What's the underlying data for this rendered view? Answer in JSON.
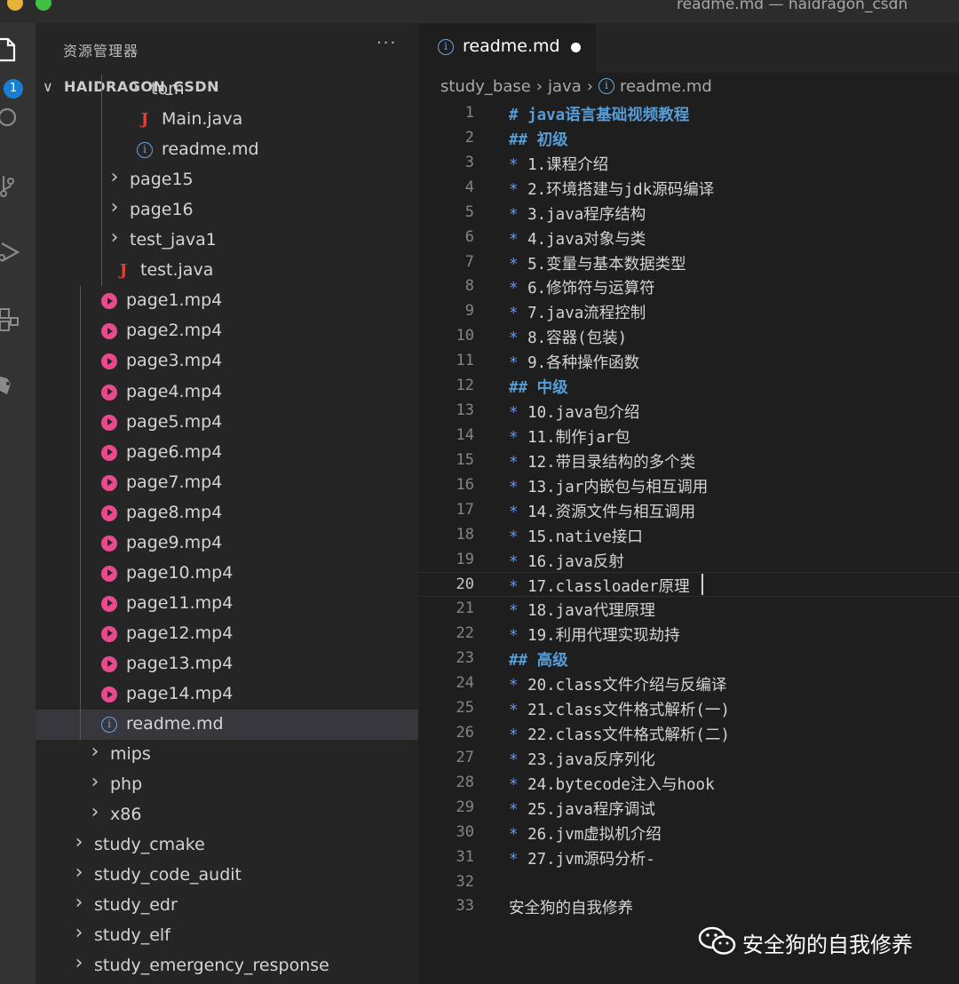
{
  "window": {
    "title": "readme.md — haidragon_csdn"
  },
  "activity_bar": {
    "badge_count": "1",
    "icons": [
      "files-icon",
      "search-icon",
      "source-control-icon",
      "run-debug-icon",
      "extensions-icon",
      "remote-icon"
    ]
  },
  "sidebar": {
    "title": "资源管理器",
    "more_label": "···",
    "workspace": "HAIDRAGON_CSDN",
    "items": [
      {
        "label": "tom",
        "kind": "folder",
        "depth": 3
      },
      {
        "label": "Main.java",
        "kind": "java",
        "depth": 3
      },
      {
        "label": "readme.md",
        "kind": "info",
        "depth": 3
      },
      {
        "label": "page15",
        "kind": "folder",
        "depth": 2
      },
      {
        "label": "page16",
        "kind": "folder",
        "depth": 2
      },
      {
        "label": "test_java1",
        "kind": "folder",
        "depth": 2
      },
      {
        "label": "test.java",
        "kind": "java",
        "depth": 2
      },
      {
        "label": "page1.mp4",
        "kind": "media",
        "depth": 1
      },
      {
        "label": "page2.mp4",
        "kind": "media",
        "depth": 1
      },
      {
        "label": "page3.mp4",
        "kind": "media",
        "depth": 1
      },
      {
        "label": "page4.mp4",
        "kind": "media",
        "depth": 1
      },
      {
        "label": "page5.mp4",
        "kind": "media",
        "depth": 1
      },
      {
        "label": "page6.mp4",
        "kind": "media",
        "depth": 1
      },
      {
        "label": "page7.mp4",
        "kind": "media",
        "depth": 1
      },
      {
        "label": "page8.mp4",
        "kind": "media",
        "depth": 1
      },
      {
        "label": "page9.mp4",
        "kind": "media",
        "depth": 1
      },
      {
        "label": "page10.mp4",
        "kind": "media",
        "depth": 1
      },
      {
        "label": "page11.mp4",
        "kind": "media",
        "depth": 1
      },
      {
        "label": "page12.mp4",
        "kind": "media",
        "depth": 1
      },
      {
        "label": "page13.mp4",
        "kind": "media",
        "depth": 1
      },
      {
        "label": "page14.mp4",
        "kind": "media",
        "depth": 1
      },
      {
        "label": "readme.md",
        "kind": "info",
        "depth": 1,
        "selected": true
      },
      {
        "label": "mips",
        "kind": "folder",
        "depth": 1
      },
      {
        "label": "php",
        "kind": "folder",
        "depth": 1
      },
      {
        "label": "x86",
        "kind": "folder",
        "depth": 1
      },
      {
        "label": "study_cmake",
        "kind": "folder",
        "depth": 0
      },
      {
        "label": "study_code_audit",
        "kind": "folder",
        "depth": 0
      },
      {
        "label": "study_edr",
        "kind": "folder",
        "depth": 0
      },
      {
        "label": "study_elf",
        "kind": "folder",
        "depth": 0
      },
      {
        "label": "study_emergency_response",
        "kind": "folder",
        "depth": 0
      }
    ]
  },
  "editor": {
    "tab": {
      "label": "readme.md",
      "unsaved": true
    },
    "breadcrumb": [
      "study_base",
      "java",
      "readme.md"
    ],
    "current_line": 20,
    "lines": [
      {
        "n": "1",
        "text": "# java语言基础视频教程",
        "kind": "heading"
      },
      {
        "n": "2",
        "text": "## 初级",
        "kind": "heading"
      },
      {
        "n": "3",
        "text": "1.课程介绍",
        "kind": "bullet"
      },
      {
        "n": "4",
        "text": "2.环境搭建与jdk源码编译",
        "kind": "bullet"
      },
      {
        "n": "5",
        "text": "3.java程序结构",
        "kind": "bullet"
      },
      {
        "n": "6",
        "text": "4.java对象与类",
        "kind": "bullet"
      },
      {
        "n": "7",
        "text": "5.变量与基本数据类型",
        "kind": "bullet"
      },
      {
        "n": "8",
        "text": "6.修饰符与运算符",
        "kind": "bullet"
      },
      {
        "n": "9",
        "text": "7.java流程控制",
        "kind": "bullet"
      },
      {
        "n": "10",
        "text": "8.容器(包装)",
        "kind": "bullet"
      },
      {
        "n": "11",
        "text": "9.各种操作函数",
        "kind": "bullet"
      },
      {
        "n": "12",
        "text": "## 中级",
        "kind": "heading"
      },
      {
        "n": "13",
        "text": "10.java包介绍",
        "kind": "bullet"
      },
      {
        "n": "14",
        "text": "11.制作jar包",
        "kind": "bullet"
      },
      {
        "n": "15",
        "text": "12.带目录结构的多个类",
        "kind": "bullet"
      },
      {
        "n": "16",
        "text": "13.jar内嵌包与相互调用",
        "kind": "bullet"
      },
      {
        "n": "17",
        "text": "14.资源文件与相互调用",
        "kind": "bullet"
      },
      {
        "n": "18",
        "text": "15.native接口",
        "kind": "bullet"
      },
      {
        "n": "19",
        "text": "16.java反射",
        "kind": "bullet"
      },
      {
        "n": "20",
        "text": "17.classloader原理",
        "kind": "bullet"
      },
      {
        "n": "21",
        "text": "18.java代理原理",
        "kind": "bullet"
      },
      {
        "n": "22",
        "text": "19.利用代理实现劫持",
        "kind": "bullet"
      },
      {
        "n": "23",
        "text": "## 高级",
        "kind": "heading"
      },
      {
        "n": "24",
        "text": "20.class文件介绍与反编译",
        "kind": "bullet"
      },
      {
        "n": "25",
        "text": "21.class文件格式解析(一)",
        "kind": "bullet"
      },
      {
        "n": "26",
        "text": "22.class文件格式解析(二)",
        "kind": "bullet"
      },
      {
        "n": "27",
        "text": "23.java反序列化",
        "kind": "bullet"
      },
      {
        "n": "28",
        "text": "24.bytecode注入与hook",
        "kind": "bullet"
      },
      {
        "n": "29",
        "text": "25.java程序调试",
        "kind": "bullet"
      },
      {
        "n": "30",
        "text": "26.jvm虚拟机介绍",
        "kind": "bullet"
      },
      {
        "n": "31",
        "text": "27.jvm源码分析-",
        "kind": "bullet"
      },
      {
        "n": "32",
        "text": "",
        "kind": "plain"
      },
      {
        "n": "33",
        "text": "安全狗的自我修养",
        "kind": "plain"
      }
    ]
  },
  "watermark": {
    "text": "安全狗的自我修养",
    "icon": "wechat-icon"
  },
  "colors": {
    "accent_blue": "#569cd6",
    "media_pink": "#e84a8c",
    "java_red": "#e0403b",
    "badge_blue": "#1a7fd4"
  }
}
